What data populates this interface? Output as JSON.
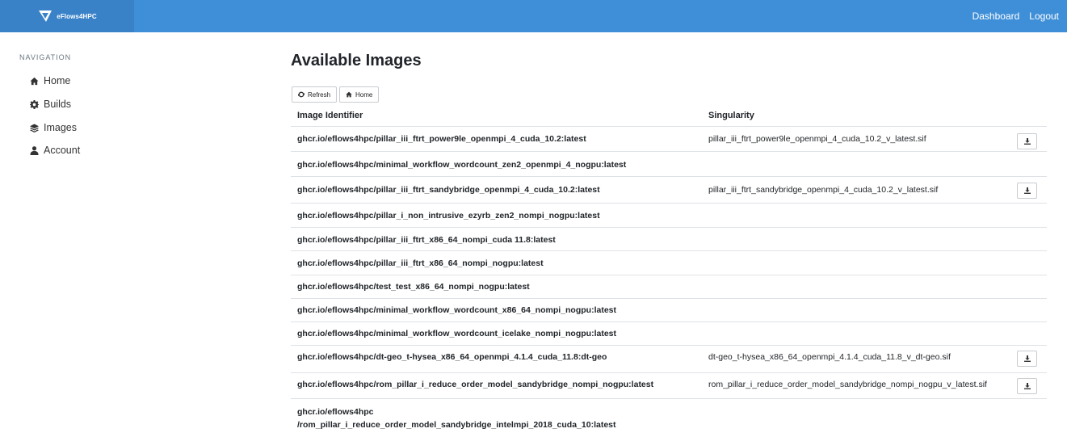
{
  "brand": {
    "name": "eFlows4HPC"
  },
  "topnav": {
    "dashboard": "Dashboard",
    "logout": "Logout"
  },
  "sidebar": {
    "heading": "NAVIGATION",
    "items": [
      {
        "label": "Home",
        "icon": "home-icon"
      },
      {
        "label": "Builds",
        "icon": "gear-icon"
      },
      {
        "label": "Images",
        "icon": "layers-icon"
      },
      {
        "label": "Account",
        "icon": "user-icon"
      }
    ]
  },
  "main": {
    "title": "Available Images",
    "buttons": {
      "refresh": "Refresh",
      "home": "Home"
    },
    "table": {
      "headers": {
        "image": "Image Identifier",
        "singularity": "Singularity"
      },
      "rows": [
        {
          "image": "ghcr.io/eflows4hpc/pillar_iii_ftrt_power9le_openmpi_4_cuda_10.2:latest",
          "sif": "pillar_iii_ftrt_power9le_openmpi_4_cuda_10.2_v_latest.sif"
        },
        {
          "image": "ghcr.io/eflows4hpc/minimal_workflow_wordcount_zen2_openmpi_4_nogpu:latest",
          "sif": ""
        },
        {
          "image": "ghcr.io/eflows4hpc/pillar_iii_ftrt_sandybridge_openmpi_4_cuda_10.2:latest",
          "sif": "pillar_iii_ftrt_sandybridge_openmpi_4_cuda_10.2_v_latest.sif"
        },
        {
          "image": "ghcr.io/eflows4hpc/pillar_i_non_intrusive_ezyrb_zen2_nompi_nogpu:latest",
          "sif": ""
        },
        {
          "image": "ghcr.io/eflows4hpc/pillar_iii_ftrt_x86_64_nompi_cuda 11.8:latest",
          "sif": ""
        },
        {
          "image": "ghcr.io/eflows4hpc/pillar_iii_ftrt_x86_64_nompi_nogpu:latest",
          "sif": ""
        },
        {
          "image": "ghcr.io/eflows4hpc/test_test_x86_64_nompi_nogpu:latest",
          "sif": ""
        },
        {
          "image": "ghcr.io/eflows4hpc/minimal_workflow_wordcount_x86_64_nompi_nogpu:latest",
          "sif": ""
        },
        {
          "image": "ghcr.io/eflows4hpc/minimal_workflow_wordcount_icelake_nompi_nogpu:latest",
          "sif": ""
        },
        {
          "image": "ghcr.io/eflows4hpc/dt-geo_t-hysea_x86_64_openmpi_4.1.4_cuda_11.8:dt-geo",
          "sif": "dt-geo_t-hysea_x86_64_openmpi_4.1.4_cuda_11.8_v_dt-geo.sif"
        },
        {
          "image": "ghcr.io/eflows4hpc/rom_pillar_i_reduce_order_model_sandybridge_nompi_nogpu:latest",
          "sif": "rom_pillar_i_reduce_order_model_sandybridge_nompi_nogpu_v_latest.sif"
        },
        {
          "image_line1": "ghcr.io/eflows4hpc",
          "image_line2": "/rom_pillar_i_reduce_order_model_sandybridge_intelmpi_2018_cuda_10:latest",
          "sif": ""
        }
      ]
    }
  }
}
